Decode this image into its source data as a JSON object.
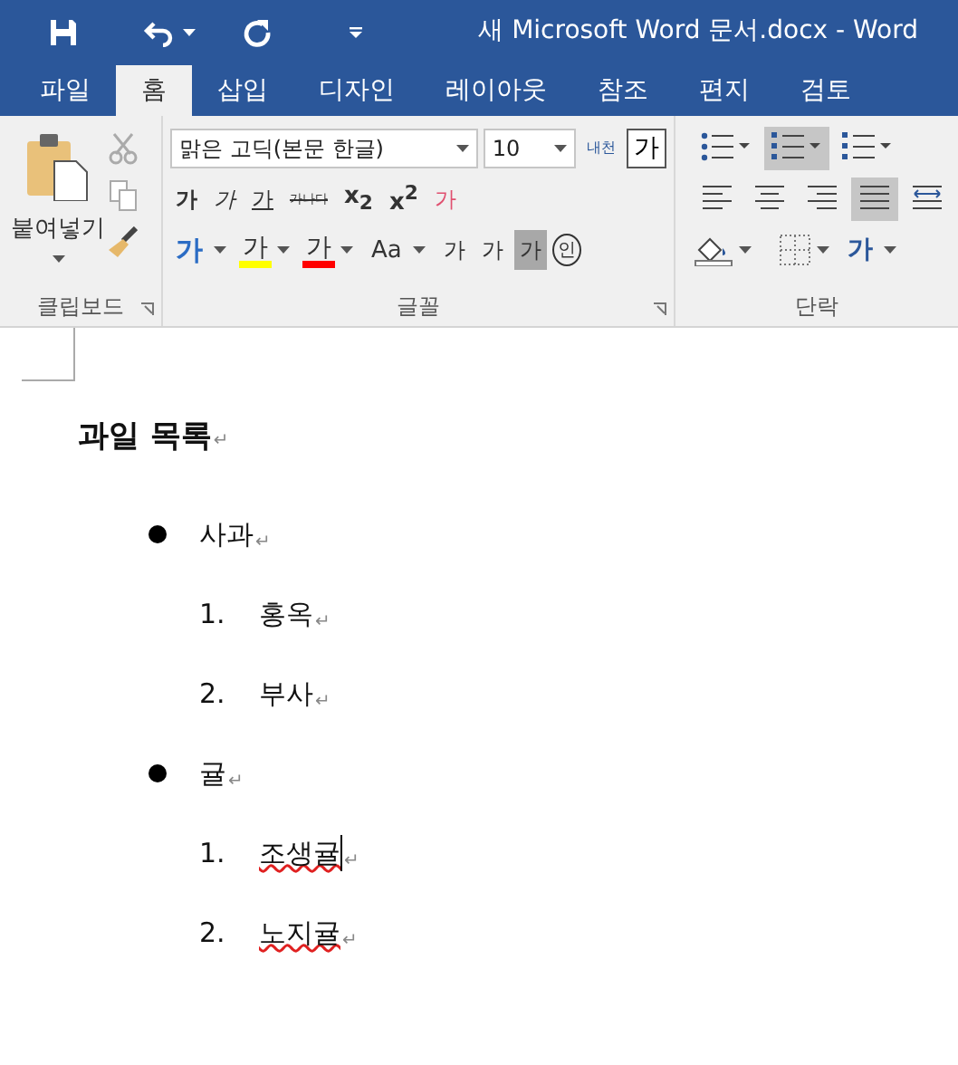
{
  "window": {
    "title": "새 Microsoft Word 문서.docx - Word"
  },
  "tabs": [
    {
      "label": "파일",
      "selected": false
    },
    {
      "label": "홈",
      "selected": true
    },
    {
      "label": "삽입",
      "selected": false
    },
    {
      "label": "디자인",
      "selected": false
    },
    {
      "label": "레이아웃",
      "selected": false
    },
    {
      "label": "참조",
      "selected": false
    },
    {
      "label": "편지",
      "selected": false
    },
    {
      "label": "검토",
      "selected": false
    }
  ],
  "clipboard": {
    "paste_label": "붙여넣기",
    "group_label": "클립보드"
  },
  "font": {
    "group_label": "글꼴",
    "font_name": "맑은 고딕(본문 한글)",
    "font_size": "10",
    "phonetic_label": "내천",
    "char_border_text": "가",
    "row_1": [
      {
        "kind": "bold",
        "text": "가"
      },
      {
        "kind": "italic",
        "text": "가"
      },
      {
        "kind": "underline",
        "text": "가"
      },
      {
        "kind": "strike",
        "text": "가나다"
      },
      {
        "kind": "script",
        "text": "x$_{2}$"
      },
      {
        "kind": "script",
        "text": "x$^{2}$"
      },
      {
        "kind": "clear",
        "text": "가"
      }
    ],
    "row_2": [
      {
        "kind": "effect",
        "text": "가"
      },
      {
        "kind": "highlight",
        "text": "가",
        "color": "#ffff00"
      },
      {
        "kind": "color",
        "text": "가",
        "color": "#ff0000"
      },
      {
        "kind": "case",
        "text": "Aa"
      },
      {
        "kind": "grow",
        "text": "가"
      },
      {
        "kind": "shrink",
        "text": "가"
      },
      {
        "kind": "shade",
        "text": "가"
      },
      {
        "kind": "enclose",
        "text": "인"
      }
    ]
  },
  "paragraph": {
    "group_label": "단락",
    "list_buttons": [
      {
        "kind": "bullets",
        "selected": false
      },
      {
        "kind": "numbering",
        "selected": true
      },
      {
        "kind": "multilevel",
        "selected": false
      }
    ],
    "align_buttons": [
      {
        "kind": "left",
        "selected": false
      },
      {
        "kind": "center",
        "selected": false
      },
      {
        "kind": "right",
        "selected": false
      },
      {
        "kind": "justify",
        "selected": true
      },
      {
        "kind": "distributed",
        "selected": false
      }
    ],
    "direction_text": "가"
  },
  "document": {
    "heading": {
      "text": "과일 목록",
      "mark": "↵"
    },
    "items": [
      {
        "kind": "bullet",
        "text": "사과",
        "mark": "↵",
        "misspelled": false,
        "cursor": false,
        "children": [
          {
            "kind": "number",
            "number": "1.",
            "text": "홍옥",
            "mark": "↵",
            "misspelled": false,
            "cursor": false
          },
          {
            "kind": "number",
            "number": "2.",
            "text": "부사",
            "mark": "↵",
            "misspelled": false,
            "cursor": false
          }
        ]
      },
      {
        "kind": "bullet",
        "text": "귤",
        "mark": "↵",
        "misspelled": false,
        "cursor": false,
        "children": [
          {
            "kind": "number",
            "number": "1.",
            "text": "조생귤",
            "mark": "↵",
            "misspelled": true,
            "cursor": true
          },
          {
            "kind": "number",
            "number": "2.",
            "text": "노지귤",
            "mark": "↵",
            "misspelled": true,
            "cursor": false
          }
        ]
      }
    ]
  }
}
